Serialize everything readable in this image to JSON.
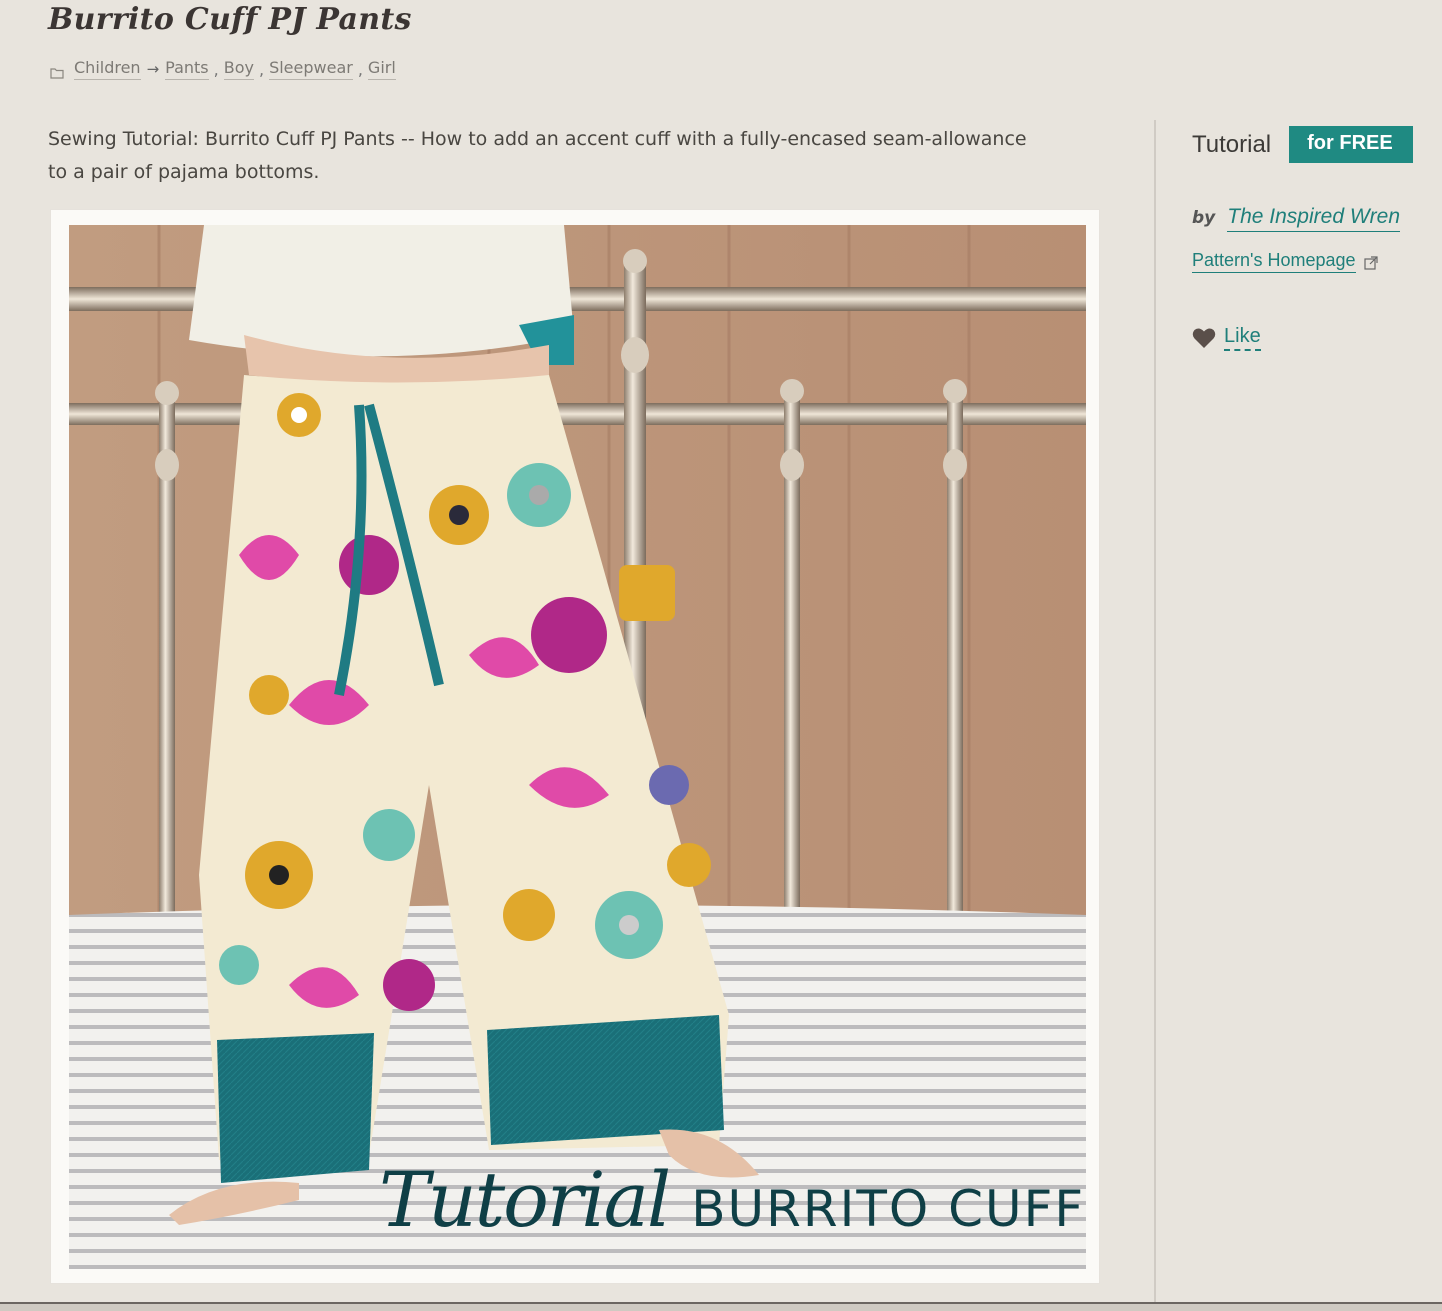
{
  "page": {
    "title": "Burrito Cuff PJ Pants",
    "description": "Sewing Tutorial: Burrito Cuff PJ Pants -- How to add an accent cuff with a fully-encased seam-allowance to a pair of pajama bottoms."
  },
  "breadcrumb": {
    "icon": "folder-icon",
    "items": [
      "Children",
      "Pants",
      "Boy",
      "Sleepwear",
      "Girl"
    ],
    "arrow": "→",
    "separator": ","
  },
  "photo": {
    "caption_script": "Tutorial",
    "caption_caps": "BURRITO CUFF"
  },
  "sidebar": {
    "type_label": "Tutorial",
    "price_badge": "for FREE",
    "by_label": "by",
    "author": "The Inspired Wren",
    "homepage_label": "Pattern's Homepage",
    "like_label": "Like"
  },
  "colors": {
    "accent": "#1f8a82",
    "link": "#1f7f7a",
    "background": "#e8e4dd"
  }
}
